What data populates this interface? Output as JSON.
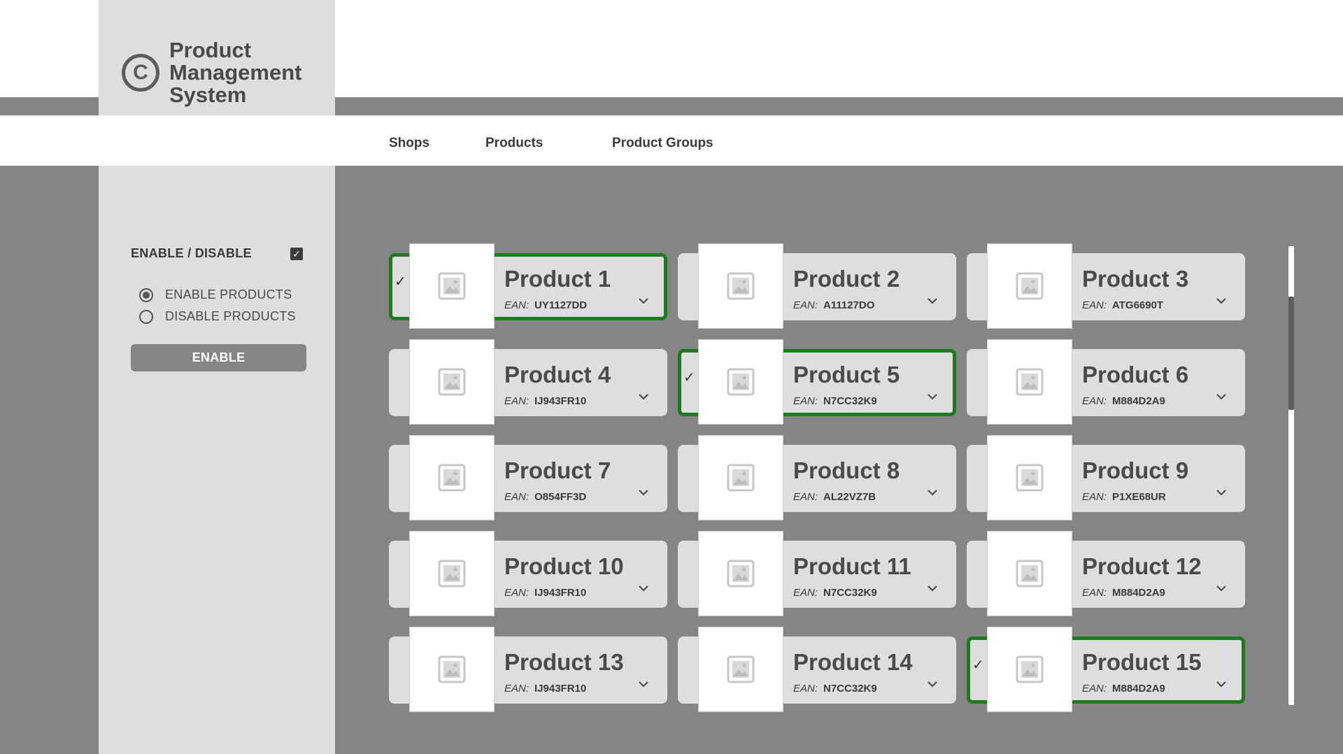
{
  "app": {
    "title": "Product Management System",
    "logo_glyph": "C"
  },
  "nav": [
    {
      "label": "Shops"
    },
    {
      "label": "Products"
    },
    {
      "label": "Product Groups"
    }
  ],
  "sidebar": {
    "toggle_label": "ENABLE / DISABLE",
    "toggle_checked": true,
    "options": [
      {
        "label": "ENABLE PRODUCTS",
        "checked": true
      },
      {
        "label": "DISABLE PRODUCTS",
        "checked": false
      }
    ],
    "button_label": "ENABLE"
  },
  "products": {
    "ean_label": "EAN:",
    "items": [
      {
        "name": "Product 1",
        "ean": "UY1127DD",
        "selected": true
      },
      {
        "name": "Product 2",
        "ean": "A11127DO",
        "selected": false
      },
      {
        "name": "Product 3",
        "ean": "ATG6690T",
        "selected": false
      },
      {
        "name": "Product 4",
        "ean": "IJ943FR10",
        "selected": false
      },
      {
        "name": "Product 5",
        "ean": "N7CC32K9",
        "selected": true
      },
      {
        "name": "Product 6",
        "ean": "M884D2A9",
        "selected": false
      },
      {
        "name": "Product 7",
        "ean": "O854FF3D",
        "selected": false
      },
      {
        "name": "Product 8",
        "ean": "AL22VZ7B",
        "selected": false
      },
      {
        "name": "Product 9",
        "ean": "P1XE68UR",
        "selected": false
      },
      {
        "name": "Product 10",
        "ean": "IJ943FR10",
        "selected": false
      },
      {
        "name": "Product 11",
        "ean": "N7CC32K9",
        "selected": false
      },
      {
        "name": "Product 12",
        "ean": "M884D2A9",
        "selected": false
      },
      {
        "name": "Product 13",
        "ean": "IJ943FR10",
        "selected": false
      },
      {
        "name": "Product 14",
        "ean": "N7CC32K9",
        "selected": false
      },
      {
        "name": "Product 15",
        "ean": "M884D2A9",
        "selected": true
      }
    ]
  },
  "colors": {
    "selected_border": "#1f7a1f",
    "panel": "#dedee0",
    "backdrop": "#858585"
  }
}
